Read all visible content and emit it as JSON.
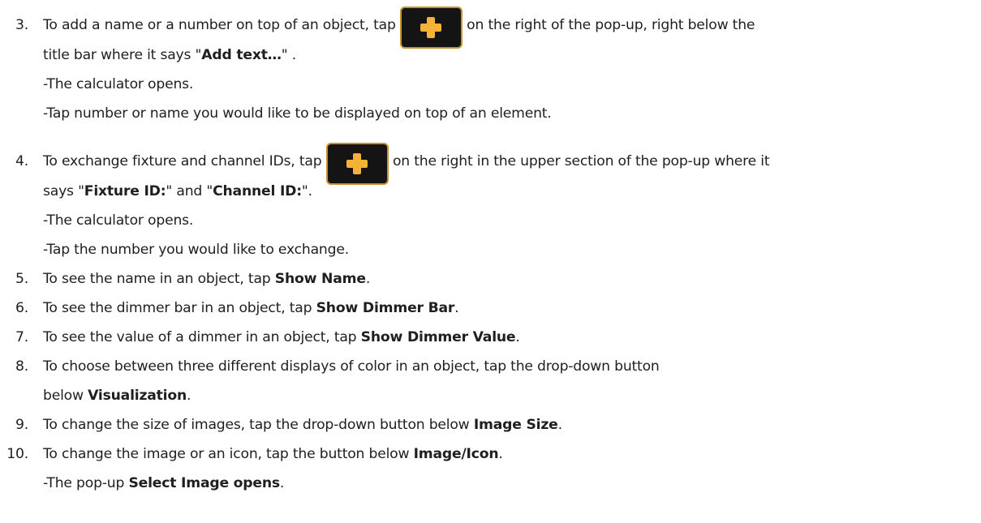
{
  "steps": [
    {
      "number": "3.",
      "line1_a": "To add a name or a number on top of an object, tap ",
      "line1_b": " on the right of the pop-up, right below the",
      "line2_a": "title bar where it says \"",
      "line2_bold": "Add text…",
      "line2_c": "\" .",
      "line3": "-The calculator opens.",
      "line4": "-Tap number or name you would like to be displayed on top of an element."
    },
    {
      "number": "4.",
      "line1_a": "To exchange fixture and channel IDs, tap ",
      "line1_b": " on the right in the upper section of the pop-up where it",
      "line2_a": "says \"",
      "line2_bold1": "Fixture ID:",
      "line2_b": "\" and \"",
      "line2_bold2": "Channel ID:",
      "line2_c": "\".",
      "line3": "-The calculator opens.",
      "line4": "-Tap the number you would like to exchange."
    },
    {
      "number": "5.",
      "text": "To see the name in an object, tap ",
      "bold": "Show Name",
      "end": "."
    },
    {
      "number": "6.",
      "text": "To see the dimmer bar in an object, tap ",
      "bold": "Show Dimmer Bar",
      "end": "."
    },
    {
      "number": "7.",
      "text": "To see the value of a dimmer in an object, tap ",
      "bold": "Show Dimmer Value",
      "end": "."
    },
    {
      "number": "8.",
      "text": "To choose between three different displays of color in an object, tap the drop-down button",
      "line2_a": "below ",
      "line2_bold": "Visualization",
      "line2_end": "."
    },
    {
      "number": "9.",
      "text": "To change the size of images, tap the drop-down button below ",
      "bold": "Image Size",
      "end": "."
    },
    {
      "number": "10.",
      "text": "To change the image or an icon, tap the button below ",
      "bold": "Image/Icon",
      "end": ".",
      "line2_a": "-The pop-up ",
      "line2_bold": "Select Image opens",
      "line2_end": "."
    }
  ],
  "icons": {
    "add_button": "plus-icon",
    "accent_color": "#f4b336",
    "button_bg": "#141414"
  }
}
